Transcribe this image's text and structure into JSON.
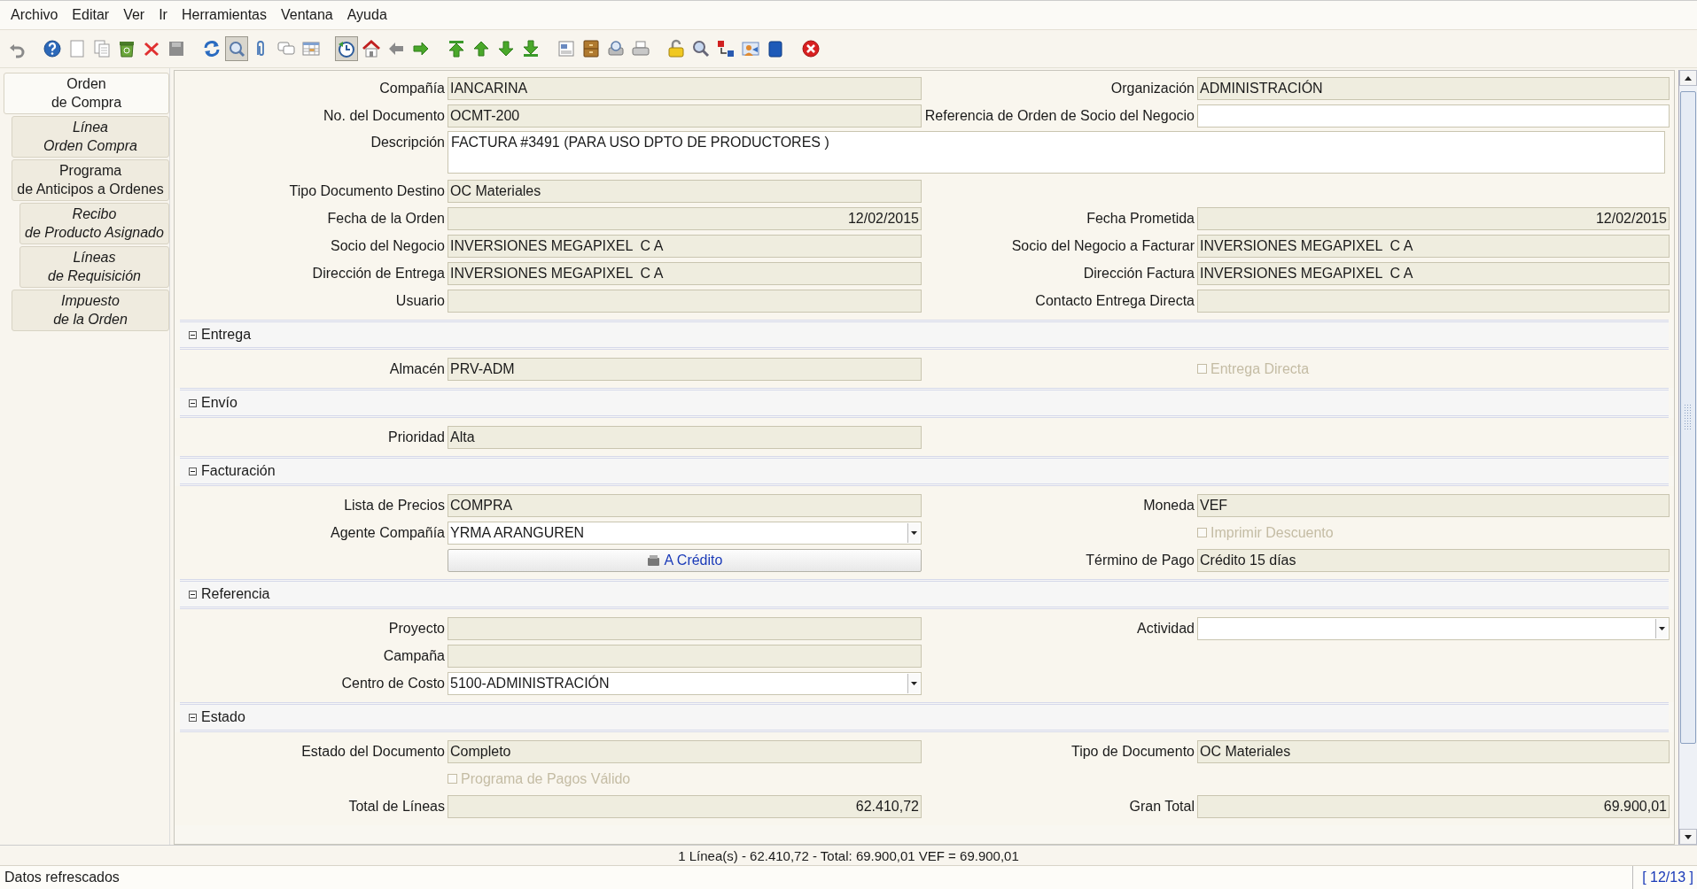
{
  "menu": [
    "Archivo",
    "Editar",
    "Ver",
    "Ir",
    "Herramientas",
    "Ventana",
    "Ayuda"
  ],
  "toolbar": [
    {
      "pressed": false
    },
    {
      "pressed": false
    },
    {
      "pressed": false
    },
    {
      "pressed": false
    },
    {
      "pressed": false
    },
    {
      "pressed": false
    },
    {
      "pressed": false
    },
    {
      "pressed": false
    },
    {
      "pressed": true
    },
    {
      "pressed": false
    },
    {
      "pressed": false
    },
    {
      "pressed": false
    },
    {
      "pressed": true
    },
    {
      "pressed": false
    },
    {
      "pressed": false
    },
    {
      "pressed": false
    },
    {
      "pressed": false
    },
    {
      "pressed": false
    },
    {
      "pressed": false
    },
    {
      "pressed": false
    },
    {
      "pressed": false
    },
    {
      "pressed": false
    },
    {
      "pressed": false
    },
    {
      "pressed": false
    },
    {
      "pressed": false
    },
    {
      "pressed": false
    },
    {
      "pressed": false
    },
    {
      "pressed": false
    },
    {
      "pressed": false
    },
    {
      "pressed": false
    }
  ],
  "tabs": [
    {
      "lines": [
        "Orden",
        "de Compra"
      ],
      "selected": true,
      "read_only": false,
      "children": [
        {
          "lines": [
            "Línea",
            "Orden Compra"
          ],
          "selected": false,
          "read_only": true
        },
        {
          "lines": [
            "Programa",
            "de Anticipos a Ordenes"
          ],
          "selected": false,
          "read_only": false,
          "children": [
            {
              "lines": [
                "Recibo",
                "de Producto Asignado"
              ],
              "selected": false,
              "read_only": true
            },
            {
              "lines": [
                "Líneas",
                "de Requisición"
              ],
              "selected": false,
              "read_only": true
            }
          ]
        },
        {
          "lines": [
            "Impuesto",
            "de la Orden"
          ],
          "selected": false,
          "read_only": true
        }
      ]
    }
  ],
  "sections": [
    {
      "rows": [
        [
          {
            "kind": "text",
            "label": "Compañía",
            "value": "IANCARINA",
            "read_only": true
          },
          {
            "kind": "text",
            "label": "Organización",
            "value": "ADMINISTRACIÓN",
            "read_only": true
          }
        ],
        [
          {
            "kind": "text",
            "label": "No. del Documento",
            "value": "OCMT-200",
            "read_only": true
          },
          {
            "kind": "text",
            "label": "Referencia de Orden de Socio del Negocio",
            "read_only": false
          }
        ],
        [
          {
            "kind": "textarea",
            "label": "Descripción",
            "value": "FACTURA #3491 (PARA USO DPTO DE PRODUCTORES )",
            "read_only": false
          }
        ],
        [
          {
            "kind": "text",
            "label": "Tipo Documento Destino",
            "value": "OC Materiales",
            "read_only": true
          },
          {
            "kind": "empty"
          }
        ],
        [
          {
            "kind": "number",
            "label": "Fecha de la Orden",
            "value": "12/02/2015",
            "read_only": true
          },
          {
            "kind": "number",
            "label": "Fecha Prometida",
            "value": "12/02/2015",
            "read_only": true
          }
        ],
        [
          {
            "kind": "text",
            "label": "Socio del Negocio",
            "value": "INVERSIONES MEGAPIXEL  C A",
            "read_only": true
          },
          {
            "kind": "text",
            "label": "Socio del Negocio a Facturar",
            "value": "INVERSIONES MEGAPIXEL  C A",
            "read_only": true
          }
        ],
        [
          {
            "kind": "text",
            "label": "Dirección de Entrega",
            "value": "INVERSIONES MEGAPIXEL  C A",
            "read_only": true
          },
          {
            "kind": "text",
            "label": "Dirección Factura",
            "value": "INVERSIONES MEGAPIXEL  C A",
            "read_only": true
          }
        ],
        [
          {
            "kind": "text",
            "label": "Usuario",
            "read_only": true
          },
          {
            "kind": "text",
            "label": "Contacto Entrega Directa",
            "read_only": true
          }
        ]
      ]
    },
    {
      "title": "Entrega",
      "expanded": true,
      "rows": [
        [
          {
            "kind": "text",
            "label": "Almacén",
            "value": "PRV-ADM",
            "read_only": true
          },
          {
            "kind": "checkbox",
            "label": "Entrega Directa",
            "checked": false,
            "disabled": true
          }
        ]
      ]
    },
    {
      "title": "Envío",
      "expanded": true,
      "rows": [
        [
          {
            "kind": "text",
            "label": "Prioridad",
            "value": "Alta",
            "read_only": true
          },
          {
            "kind": "empty"
          }
        ]
      ]
    },
    {
      "title": "Facturación",
      "expanded": true,
      "rows": [
        [
          {
            "kind": "text",
            "label": "Lista de Precios",
            "value": "COMPRA",
            "read_only": true
          },
          {
            "kind": "text",
            "label": "Moneda",
            "value": "VEF",
            "read_only": true
          }
        ],
        [
          {
            "kind": "combo",
            "label": "Agente Compañía",
            "value": "YRMA ARANGUREN",
            "read_only": false
          },
          {
            "kind": "checkbox",
            "label": "Imprimir Descuento",
            "checked": false,
            "disabled": true
          }
        ],
        [
          {
            "kind": "button",
            "label": "A Crédito"
          },
          {
            "kind": "text",
            "label": "Término de Pago",
            "value": "Crédito 15 días",
            "read_only": true
          }
        ]
      ]
    },
    {
      "title": "Referencia",
      "expanded": true,
      "rows": [
        [
          {
            "kind": "text",
            "label": "Proyecto",
            "read_only": true
          },
          {
            "kind": "combo",
            "label": "Actividad",
            "read_only": false
          }
        ],
        [
          {
            "kind": "text",
            "label": "Campaña",
            "read_only": true
          },
          {
            "kind": "empty"
          }
        ],
        [
          {
            "kind": "combo",
            "label": "Centro de Costo",
            "value": "5100-ADMINISTRACIÓN",
            "read_only": false
          },
          {
            "kind": "empty"
          }
        ]
      ]
    },
    {
      "title": "Estado",
      "expanded": true,
      "rows": [
        [
          {
            "kind": "text",
            "label": "Estado del Documento",
            "value": "Completo",
            "read_only": true
          },
          {
            "kind": "text",
            "label": "Tipo de Documento",
            "value": "OC Materiales",
            "read_only": true
          }
        ],
        [
          {
            "kind": "checkbox",
            "label": "Programa de Pagos Válido",
            "checked": false,
            "disabled": true
          },
          {
            "kind": "empty"
          }
        ],
        [
          {
            "kind": "number",
            "label": "Total de Líneas",
            "value": "62.410,72",
            "read_only": true
          },
          {
            "kind": "number",
            "label": "Gran Total",
            "value": "69.900,01",
            "read_only": true
          }
        ]
      ]
    }
  ],
  "summary": "1 Línea(s) - 62.410,72 -  Total: 69.900,01  VEF =  69.900,01",
  "status_bar": {
    "message": "Datos refrescados",
    "record": "[ 12/13 ]"
  }
}
